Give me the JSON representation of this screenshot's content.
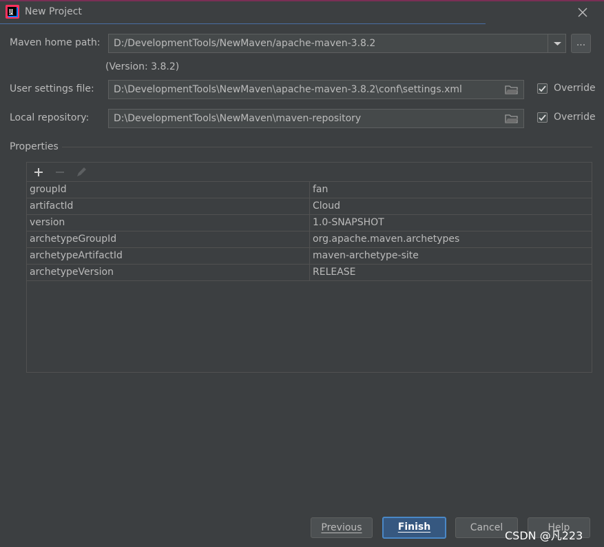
{
  "window": {
    "title": "New Project",
    "icons": {
      "app": "intellij-idea-icon",
      "close": "close-icon"
    }
  },
  "form": {
    "maven_home": {
      "label": "Maven home path:",
      "value": "D:/DevelopmentTools/NewMaven/apache-maven-3.8.2",
      "version": "(Version: 3.8.2)",
      "browse_label": "..."
    },
    "user_settings": {
      "label": "User settings file:",
      "value": "D:\\DevelopmentTools\\NewMaven\\apache-maven-3.8.2\\conf\\settings.xml",
      "override_label": "Override",
      "override_checked": true
    },
    "local_repo": {
      "label": "Local repository:",
      "value": "D:\\DevelopmentTools\\NewMaven\\maven-repository",
      "override_label": "Override",
      "override_checked": true
    }
  },
  "properties": {
    "section_title": "Properties",
    "toolbar": [
      "add-icon",
      "remove-icon",
      "edit-icon"
    ],
    "rows": [
      {
        "key": "groupId",
        "value": "fan"
      },
      {
        "key": "artifactId",
        "value": "Cloud"
      },
      {
        "key": "version",
        "value": "1.0-SNAPSHOT"
      },
      {
        "key": "archetypeGroupId",
        "value": "org.apache.maven.archetypes"
      },
      {
        "key": "archetypeArtifactId",
        "value": "maven-archetype-site"
      },
      {
        "key": "archetypeVersion",
        "value": "RELEASE"
      }
    ]
  },
  "buttons": {
    "previous": "Previous",
    "finish": "Finish",
    "cancel": "Cancel",
    "help": "Help"
  },
  "watermark": "CSDN @凡223",
  "colors": {
    "background": "#3c3f41",
    "field": "#45494a",
    "primary_button": "#365880",
    "text": "#bbbbbb"
  }
}
